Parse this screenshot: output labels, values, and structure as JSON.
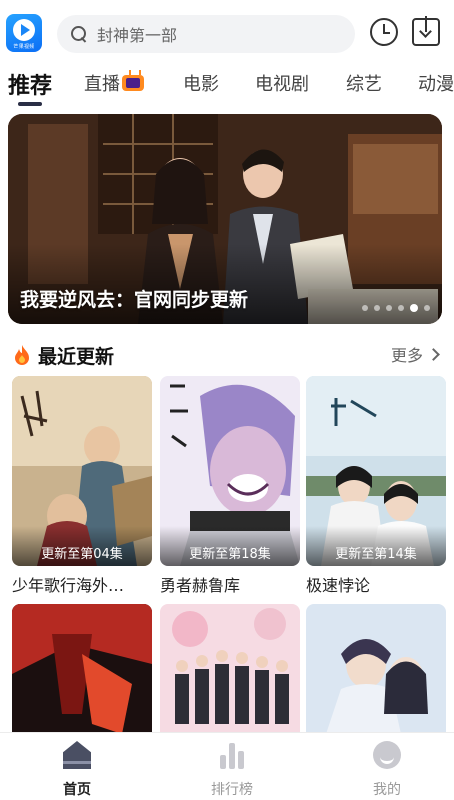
{
  "header": {
    "logo_text": "芒果视频",
    "search_placeholder": "封神第一部"
  },
  "tabs": [
    {
      "label": "推荐",
      "active": true
    },
    {
      "label": "直播",
      "active": false,
      "icon": "tv-icon"
    },
    {
      "label": "电影",
      "active": false
    },
    {
      "label": "电视剧",
      "active": false
    },
    {
      "label": "综艺",
      "active": false
    },
    {
      "label": "动漫",
      "active": false
    }
  ],
  "banner": {
    "title": "我要逆风去：官网同步更新",
    "page_count": 6,
    "active_index": 4
  },
  "section": {
    "title": "最近更新",
    "more_label": "更多"
  },
  "cards": [
    {
      "title": "少年歌行海外…",
      "episode": "更新至第04集"
    },
    {
      "title": "勇者赫鲁库",
      "episode": "更新至第18集"
    },
    {
      "title": "极速悖论",
      "episode": "更新至第14集"
    }
  ],
  "bottom_nav": [
    {
      "label": "首页",
      "icon": "home-icon",
      "active": true
    },
    {
      "label": "排行榜",
      "icon": "rank-icon",
      "active": false
    },
    {
      "label": "我的",
      "icon": "me-icon",
      "active": false
    }
  ],
  "colors": {
    "accent": "#1a86f7",
    "active_tab_underline": "#2a2e45",
    "search_bg": "#f2f3f5"
  }
}
